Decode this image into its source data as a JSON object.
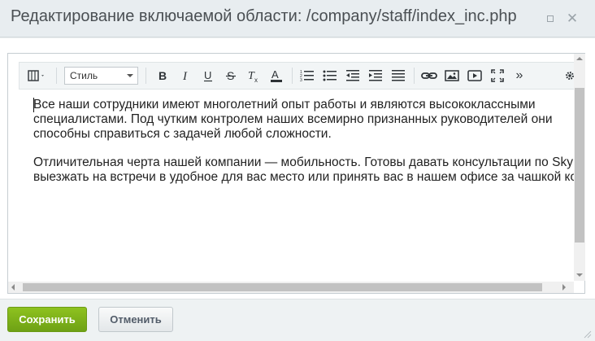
{
  "dialog": {
    "title": "Редактирование включаемой области: /company/staff/index_inc.php"
  },
  "toolbar": {
    "style_select_value": "Стиль",
    "more_label": "»",
    "buttons": [
      "view-mode",
      "bold",
      "italic",
      "underline",
      "strikethrough",
      "remove-format",
      "font-color",
      "ordered-list",
      "unordered-list",
      "outdent",
      "indent",
      "align",
      "link",
      "image",
      "video",
      "fullscreen",
      "more",
      "settings"
    ]
  },
  "editor": {
    "paragraphs": [
      "Все наши сотрудники имеют многолетний опыт работы и являются высококлассными специалистами. Под чутким контролем наших всемирно признанных руководителей они способны справиться с задачей любой сложности.",
      "Отличительная черта нашей компании — мобильность. Готовы давать консультации по Skype, выезжать на встречи в удобное для вас место или принять вас в нашем офисе за чашкой кофе."
    ]
  },
  "footer": {
    "save_label": "Сохранить",
    "cancel_label": "Отменить"
  },
  "colors": {
    "save_button": "#7bb31a",
    "title_text": "#4a4f53",
    "editor_text": "#222222"
  }
}
